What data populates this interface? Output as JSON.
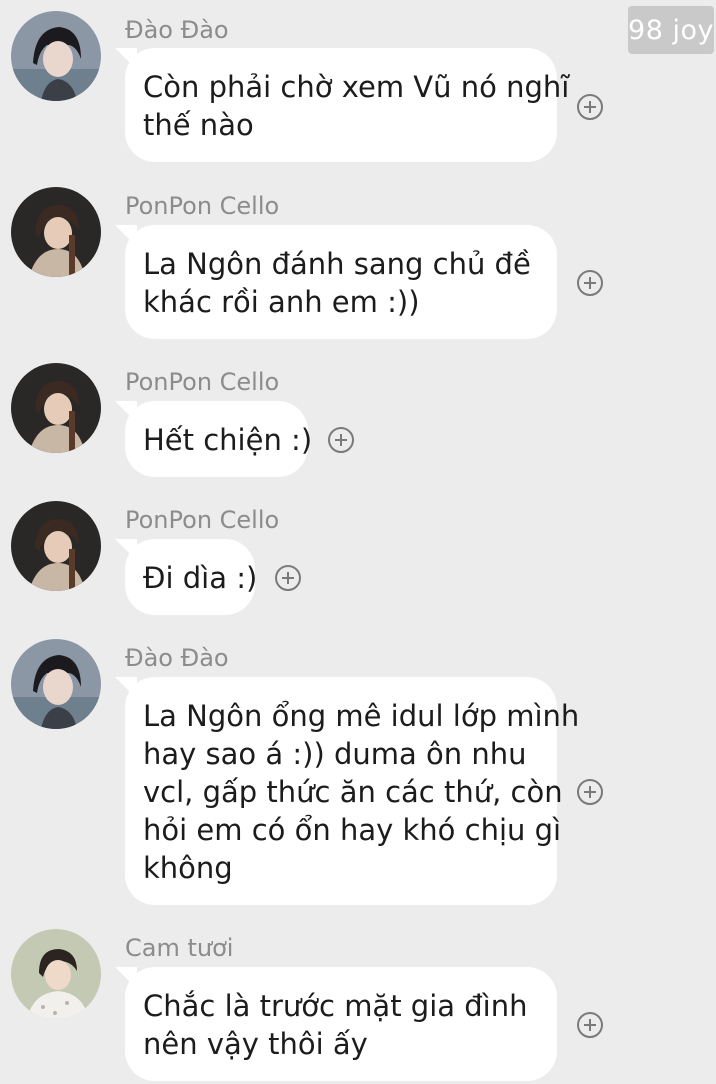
{
  "watermark": "98 joy",
  "messages": [
    {
      "sender": "Đào Đào",
      "avatar": "dao-dao-avatar",
      "lines": [
        "Còn phải chờ xem Vũ nó nghĩ",
        "thế nào"
      ]
    },
    {
      "sender": "PonPon Cello",
      "avatar": "ponpon-cello-avatar",
      "lines": [
        "La Ngôn đánh sang chủ đề",
        "khác rồi anh em :))"
      ]
    },
    {
      "sender": "PonPon Cello",
      "avatar": "ponpon-cello-avatar",
      "lines": [
        "Hết chiện :)"
      ]
    },
    {
      "sender": "PonPon Cello",
      "avatar": "ponpon-cello-avatar",
      "lines": [
        "Đi dìa :)"
      ]
    },
    {
      "sender": "Đào Đào",
      "avatar": "dao-dao-avatar",
      "lines": [
        "La Ngôn ổng mê idul lớp mình",
        "hay sao á :)) duma ôn nhu",
        "vcl, gấp thức ăn các thứ, còn",
        "hỏi em có ổn hay khó chịu gì",
        "không"
      ]
    },
    {
      "sender": "Cam tươi",
      "avatar": "cam-tuoi-avatar",
      "lines": [
        "Chắc là trước mặt gia đình",
        "nên vậy thôi ấy"
      ]
    }
  ],
  "icons": {
    "react": "add-reaction-icon"
  }
}
